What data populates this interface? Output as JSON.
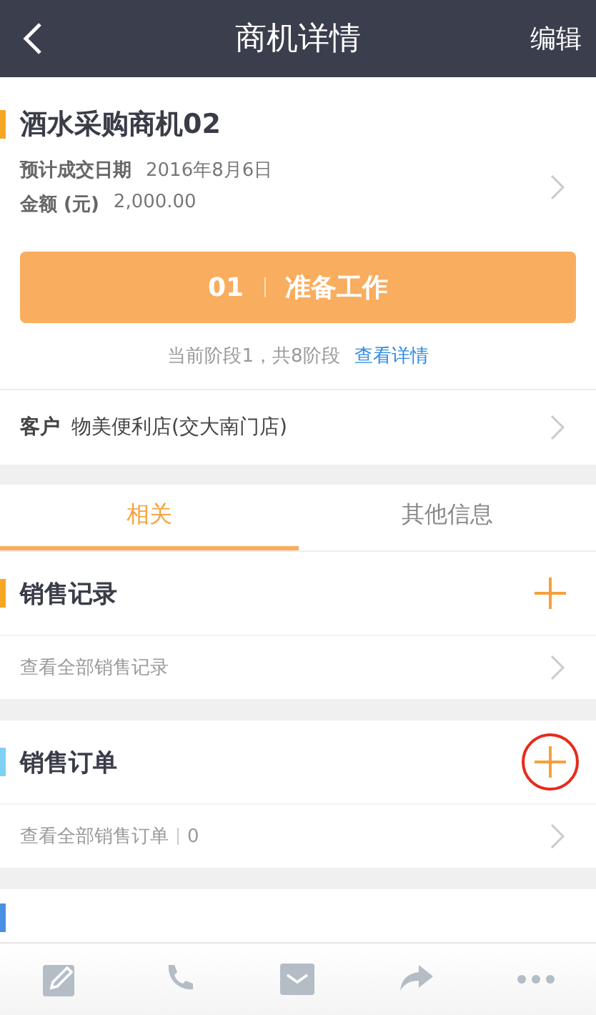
{
  "header": {
    "title": "商机详情",
    "action": "编辑"
  },
  "deal": {
    "name": "酒水采购商机02",
    "fields": [
      {
        "label": "预计成交日期",
        "value": "2016年8月6日"
      },
      {
        "label": "金额 (元)",
        "value": "2,000.00"
      }
    ],
    "stage": {
      "number": "01",
      "name": "准备工作"
    },
    "stage_info": "当前阶段1，共8阶段",
    "stage_link": "查看详情"
  },
  "customer": {
    "label": "客户",
    "value": "物美便利店(交大南门店)"
  },
  "tabs": [
    {
      "label": "相关",
      "selected": true
    },
    {
      "label": "其他信息",
      "selected": false
    }
  ],
  "sections": [
    {
      "title": "销售记录",
      "color": "#f5a623",
      "highlighted": false,
      "link": "查看全部销售记录"
    },
    {
      "title": "销售订单",
      "color": "#7fd0f5",
      "highlighted": true,
      "link": "查看全部销售订单",
      "count": "0"
    }
  ],
  "partial_section": {
    "color": "#4a90e2"
  },
  "toolbar": [
    {
      "kind": "edit"
    },
    {
      "kind": "phone"
    },
    {
      "kind": "mail"
    },
    {
      "kind": "share"
    },
    {
      "kind": "more"
    }
  ]
}
